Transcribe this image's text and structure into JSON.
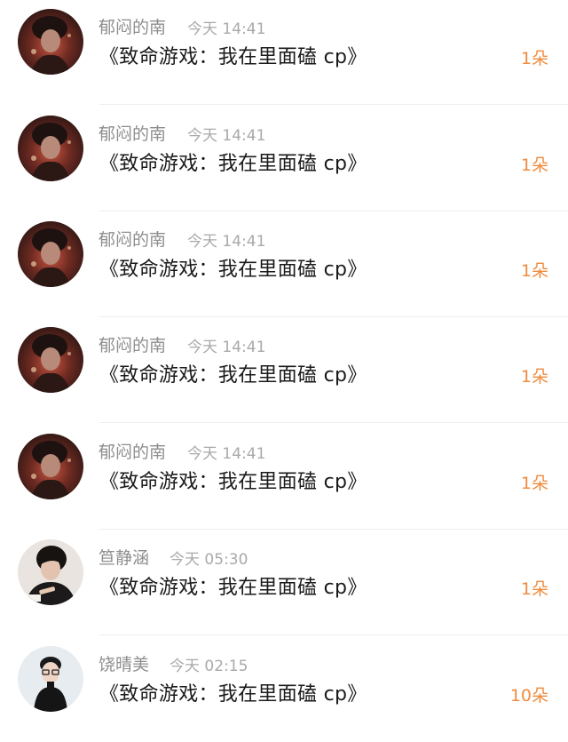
{
  "items": [
    {
      "user": "郁闷的南",
      "time": "今天 14:41",
      "book": "《致命游戏：我在里面磕 cp》",
      "gift": "1朵",
      "avatar": "dark-red-portrait"
    },
    {
      "user": "郁闷的南",
      "time": "今天 14:41",
      "book": "《致命游戏：我在里面磕 cp》",
      "gift": "1朵",
      "avatar": "dark-red-portrait"
    },
    {
      "user": "郁闷的南",
      "time": "今天 14:41",
      "book": "《致命游戏：我在里面磕 cp》",
      "gift": "1朵",
      "avatar": "dark-red-portrait"
    },
    {
      "user": "郁闷的南",
      "time": "今天 14:41",
      "book": "《致命游戏：我在里面磕 cp》",
      "gift": "1朵",
      "avatar": "dark-red-portrait"
    },
    {
      "user": "郁闷的南",
      "time": "今天 14:41",
      "book": "《致命游戏：我在里面磕 cp》",
      "gift": "1朵",
      "avatar": "dark-red-portrait"
    },
    {
      "user": "笪静涵",
      "time": "今天 05:30",
      "book": "《致命游戏：我在里面磕 cp》",
      "gift": "1朵",
      "avatar": "dark-haired-boy-photo"
    },
    {
      "user": "饶晴美",
      "time": "今天 02:15",
      "book": "《致命游戏：我在里面磕 cp》",
      "gift": "10朵",
      "avatar": "glasses-person-photo"
    }
  ],
  "colors": {
    "gift_accent": "#ef8c3f",
    "name_gray": "#8e8e8e",
    "time_gray": "#a9a9a9",
    "text_dark": "#1a1a1a"
  }
}
